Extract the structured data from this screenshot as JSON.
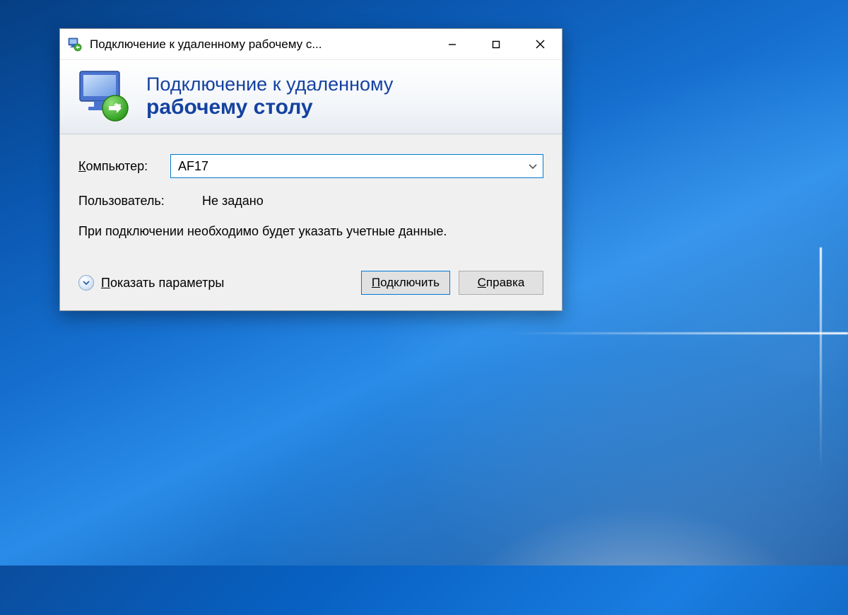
{
  "titlebar": {
    "title": "Подключение к удаленному рабочему с..."
  },
  "banner": {
    "line1": "Подключение к удаленному",
    "line2": "рабочему столу"
  },
  "form": {
    "computer_label": "Компьютер:",
    "computer_value": "AF17",
    "user_label": "Пользователь:",
    "user_value": "Не задано",
    "hint": "При подключении необходимо будет указать учетные данные."
  },
  "footer": {
    "show_options": "Показать параметры",
    "connect": "Подключить",
    "help": "Справка"
  }
}
